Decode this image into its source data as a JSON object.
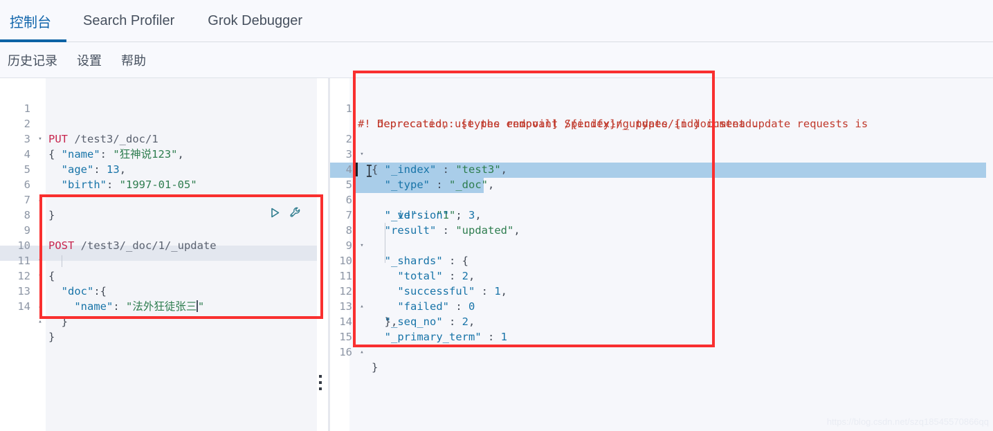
{
  "tabs": [
    {
      "label": "控制台",
      "active": true
    },
    {
      "label": "Search Profiler",
      "active": false
    },
    {
      "label": "Grok Debugger",
      "active": false
    }
  ],
  "submenu": [
    {
      "label": "历史记录"
    },
    {
      "label": "设置"
    },
    {
      "label": "帮助"
    }
  ],
  "colors": {
    "accent": "#0d63a5",
    "annotation": "#f92f2f",
    "selection": "#a9cde9",
    "current_line": "#e3e7ef",
    "method": "#c7254e",
    "key": "#1874a8",
    "string": "#2e7d4f",
    "warning": "#c0392b",
    "icon": "#2b7a8c"
  },
  "request_editor": {
    "name": "console-request-editor",
    "current_line": 12,
    "lines": [
      {
        "n": "1",
        "fold": "",
        "text": "PUT /test3/_doc/1"
      },
      {
        "n": "2",
        "fold": "▾",
        "text": "{"
      },
      {
        "n": "3",
        "fold": "",
        "text": "  \"name\": \"狂神说123\","
      },
      {
        "n": "4",
        "fold": "",
        "text": "  \"age\": 13,"
      },
      {
        "n": "5",
        "fold": "",
        "text": "  \"birth\": \"1997-01-05\""
      },
      {
        "n": "6",
        "fold": "▴",
        "text": "}"
      },
      {
        "n": "7",
        "fold": "",
        "text": ""
      },
      {
        "n": "8",
        "fold": "",
        "text": ""
      },
      {
        "n": "9",
        "fold": "",
        "text": "POST /test3/_doc/1/_update"
      },
      {
        "n": "10",
        "fold": "▾",
        "text": "{"
      },
      {
        "n": "11",
        "fold": "▾",
        "text": "  \"doc\":{"
      },
      {
        "n": "12",
        "fold": "",
        "text": "    \"name\": \"法外狂徒张三\""
      },
      {
        "n": "13",
        "fold": "▴",
        "text": "  }"
      },
      {
        "n": "14",
        "fold": "▴",
        "text": "}"
      }
    ],
    "actions": {
      "play_icon": "play-icon",
      "wrench_icon": "wrench-icon"
    },
    "resize_handle": "editor-resize-handle"
  },
  "response_editor": {
    "name": "console-response-viewer",
    "selection_lines": [
      5,
      6
    ],
    "lines": [
      {
        "n": "1",
        "fold": "",
        "text": "#! Deprecation: [types removal] Specifying types in document update requests is"
      },
      {
        "n": "",
        "fold": "",
        "text": "   deprecated, use the endpoint /{index}/_update/{id} instead."
      },
      {
        "n": "2",
        "fold": "▾",
        "text": "{"
      },
      {
        "n": "3",
        "fold": "",
        "text": "  \"_index\" : \"test3\","
      },
      {
        "n": "4",
        "fold": "",
        "text": "  \"_type\" : \"_doc\","
      },
      {
        "n": "5",
        "fold": "",
        "text": "  \"_id\" : \"1\","
      },
      {
        "n": "6",
        "fold": "",
        "text": "  \"_version\" : 3,"
      },
      {
        "n": "7",
        "fold": "",
        "text": "  \"result\" : \"updated\","
      },
      {
        "n": "8",
        "fold": "▾",
        "text": "  \"_shards\" : {"
      },
      {
        "n": "9",
        "fold": "",
        "text": "    \"total\" : 2,"
      },
      {
        "n": "10",
        "fold": "",
        "text": "    \"successful\" : 1,"
      },
      {
        "n": "11",
        "fold": "",
        "text": "    \"failed\" : 0"
      },
      {
        "n": "12",
        "fold": "▴",
        "text": "  },"
      },
      {
        "n": "13",
        "fold": "",
        "text": "  \"_seq_no\" : 2,"
      },
      {
        "n": "14",
        "fold": "",
        "text": "  \"_primary_term\" : 1"
      },
      {
        "n": "15",
        "fold": "▴",
        "text": "}"
      },
      {
        "n": "16",
        "fold": "",
        "text": ""
      }
    ]
  },
  "annotations": [
    {
      "name": "annotation-box-request",
      "target": "POST update request block"
    },
    {
      "name": "annotation-box-response",
      "target": "update response body"
    }
  ],
  "watermark": {
    "text": "https://blog.csdn.net/szq18545570866qq"
  }
}
